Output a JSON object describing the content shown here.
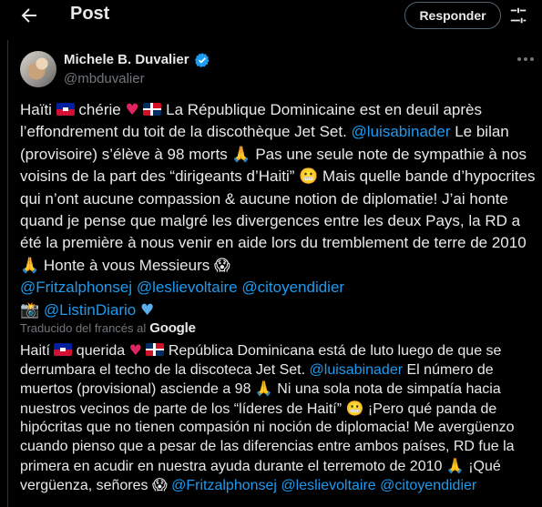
{
  "header": {
    "title": "Post",
    "reply_label": "Responder"
  },
  "author": {
    "name": "Michele B. Duvalier",
    "handle": "@mbduvalier"
  },
  "tweet": {
    "p1a": "Haïti ",
    "p1b": " chérie ",
    "p1c": " ",
    "p1d": " La République Dominicaine est en deuil après l’effondrement du toit de la discothèque Jet Set. ",
    "mention_luisabinader": "@luisabinader",
    "p1e": " Le bilan (provisoire) s’élève à 98 morts ",
    "p1f": " Pas une seule note de sympathie à nos voisins de la part des “dirigeants d’Haiti” ",
    "p1g": " Mais quelle bande d’hypocrites qui n’ont aucune compassion & aucune notion de diplomatie! J’ai honte quand je pense que malgré les divergences entre les deux Pays, la RD a été la première à nous venir en aide lors du tremblement de terre de 2010 ",
    "p1h": " Honte à vous Messieurs ",
    "mention_fritzalphonsej": "@Fritzalphonsej",
    "mention_leslievoltaire": "@leslievoltaire",
    "mention_citoyendidier": "@citoyendidier",
    "mention_listindiario": "@ListinDiario"
  },
  "translation": {
    "label": "Traducido del francés al",
    "provider": "Google",
    "t1a": "Haití ",
    "t1b": " querida ",
    "t1c": " ",
    "t1d": " República Dominicana está de luto luego de que se derrumbara el techo de la discoteca Jet Set. ",
    "t1e": " El número de muertos (provisional) asciende a 98 ",
    "t1f": " Ni una sola nota de simpatía hacia nuestros vecinos de parte de los “líderes de Haití” ",
    "t1g": " ¡Pero qué panda de hipócritas que no tienen compasión ni noción de diplomacia! Me avergüenzo cuando pienso que a pesar de las diferencias entre ambos países, RD fue la primera en acudir en nuestra ayuda durante el terremoto de 2010 ",
    "t1h": " ¡Qué vergüenza, señores ",
    "t1i": "  "
  },
  "icons": [
    "back-arrow-icon",
    "tune-icon",
    "verified-badge-icon",
    "more-icon",
    "heart-icon",
    "haiti-flag-icon",
    "dominican-flag-icon",
    "pray-icon",
    "grimace-icon",
    "scream-icon",
    "camera-icon",
    "blue-heart-icon"
  ],
  "colors": {
    "link": "#1d9bf0",
    "muted": "#71767b",
    "background": "#000000"
  }
}
